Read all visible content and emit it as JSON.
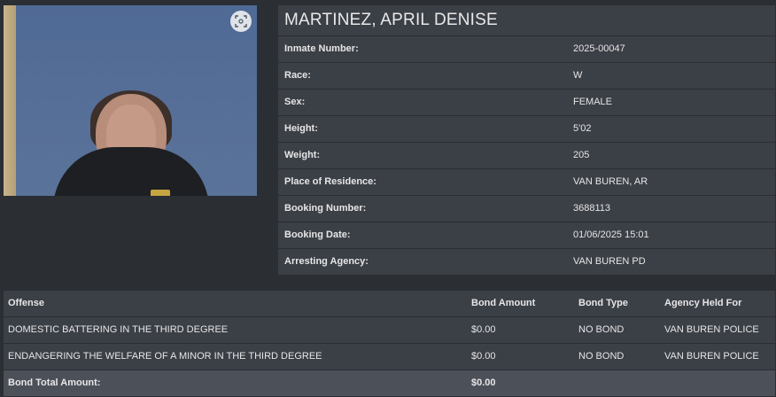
{
  "inmate": {
    "name": "MARTINEZ, APRIL DENISE",
    "fields": [
      {
        "label": "Inmate Number:",
        "value": "2025-00047"
      },
      {
        "label": "Race:",
        "value": "W"
      },
      {
        "label": "Sex:",
        "value": "FEMALE"
      },
      {
        "label": "Height:",
        "value": "5'02"
      },
      {
        "label": "Weight:",
        "value": "205"
      },
      {
        "label": "Place of Residence:",
        "value": "VAN BUREN, AR"
      },
      {
        "label": "Booking Number:",
        "value": "3688113"
      },
      {
        "label": "Booking Date:",
        "value": "01/06/2025 15:01"
      },
      {
        "label": "Arresting Agency:",
        "value": "VAN BUREN PD"
      }
    ]
  },
  "photo": {
    "zoom_icon": "expand-icon"
  },
  "offenses": {
    "headers": [
      "Offense",
      "Bond Amount",
      "Bond Type",
      "Agency Held For"
    ],
    "rows": [
      [
        "DOMESTIC BATTERING IN THE THIRD DEGREE",
        "$0.00",
        "NO BOND",
        "VAN BUREN POLICE"
      ],
      [
        "ENDANGERING THE WELFARE OF A MINOR IN THE THIRD DEGREE",
        "$0.00",
        "NO BOND",
        "VAN BUREN POLICE"
      ]
    ],
    "total_label": "Bond Total Amount:",
    "total_value": "$0.00"
  }
}
